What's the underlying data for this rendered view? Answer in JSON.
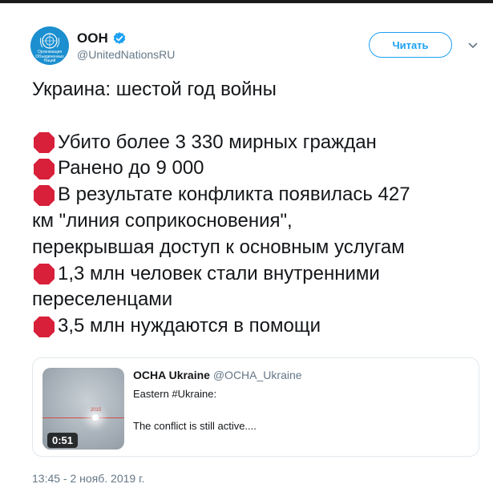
{
  "account": {
    "display_name": "ООН",
    "handle": "@UnitedNationsRU",
    "avatar_text": "Организация Объединенных Наций"
  },
  "follow_button": {
    "label": "Читать"
  },
  "tweet": {
    "lines": [
      "Украина: шестой год войны",
      "",
      "Убито более 3 330 мирных граждан",
      "Ранено до 9 000",
      "В результате конфликта появилась 427",
      "км \"линия соприкосновения\",",
      "перекрывшая доступ к основным услугам",
      "1,3 млн человек стали внутренними",
      "переселенцами",
      "3,5 млн нуждаются в помощи"
    ]
  },
  "quoted": {
    "name": "OCHA Ukraine",
    "handle": "@OCHA_Ukraine",
    "line1": "Eastern #Ukraine:",
    "line2": "The conflict is still active....",
    "video_duration": "0:51",
    "thumb_year": "2015"
  },
  "timestamp": "13:45 - 2 нояб. 2019 г.",
  "colors": {
    "accent": "#1da1f2",
    "stop_sign": "#d8203a",
    "secondary_text": "#657786",
    "avatar_bg": "#1b8fcf"
  },
  "icons": {
    "verified": "verified-badge-icon",
    "stop": "stop-sign-emoji-icon",
    "caret": "chevron-down-icon"
  }
}
